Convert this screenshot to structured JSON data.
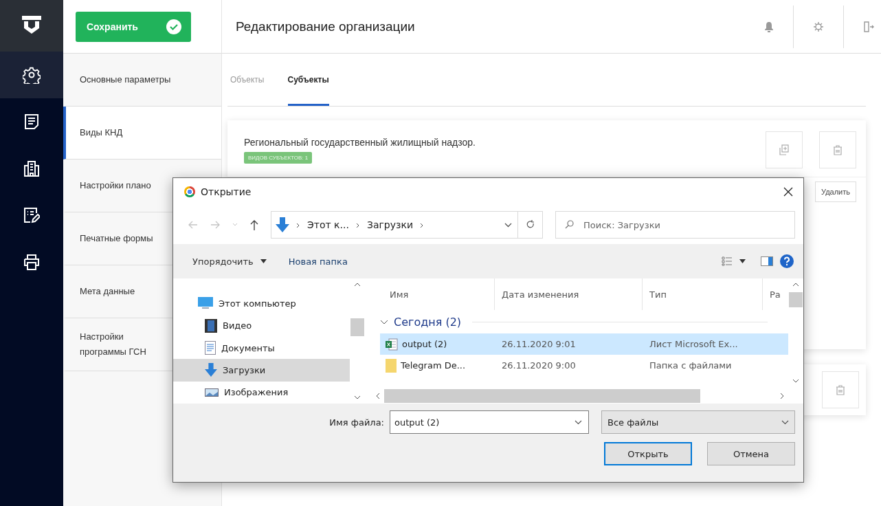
{
  "rail": [
    {
      "kind": "settings",
      "selected": true
    },
    {
      "kind": "document",
      "selected": false
    },
    {
      "kind": "building",
      "selected": false
    },
    {
      "kind": "form",
      "selected": false
    },
    {
      "kind": "printer",
      "selected": false
    }
  ],
  "header": {
    "save_button": "Сохранить",
    "title": "Редактирование организации"
  },
  "nav": [
    {
      "lines": [
        "Основные параметры"
      ],
      "selected": false
    },
    {
      "lines": [
        "Виды КНД"
      ],
      "selected": true
    },
    {
      "lines": [
        "Настройки плано"
      ],
      "selected": false
    },
    {
      "lines": [
        "Печатные формы"
      ],
      "selected": false
    },
    {
      "lines": [
        "Мета данные"
      ],
      "selected": false
    },
    {
      "lines": [
        "Настройки",
        "программы ГСН"
      ],
      "selected": false
    }
  ],
  "tabs": [
    {
      "label": "Объекты",
      "selected": false
    },
    {
      "label": "Субъекты",
      "selected": true
    }
  ],
  "card": {
    "title": "Региональный государственный жилищный надзор.",
    "badge": "ВИДОВ СУБЪЕКТОВ: 1",
    "delete_button": "Удалить"
  },
  "dialog": {
    "title": "Открытие",
    "breadcrumbs": [
      "Этот к...",
      "Загрузки"
    ],
    "search": {
      "placeholder": "Поиск: Загрузки"
    },
    "toolbar": {
      "organize": "Упорядочить",
      "new_folder": "Новая папка"
    },
    "tree": [
      {
        "label": "Этот компьютер",
        "kind": "computer",
        "selected": false,
        "children": [
          {
            "label": "Видео",
            "kind": "video",
            "selected": false
          },
          {
            "label": "Документы",
            "kind": "documents",
            "selected": false
          },
          {
            "label": "Загрузки",
            "kind": "downloads",
            "selected": true
          },
          {
            "label": "Изображения",
            "kind": "images",
            "selected": false
          }
        ]
      }
    ],
    "columns": [
      "Имя",
      "Дата изменения",
      "Тип",
      "Ра"
    ],
    "group": "Сегодня (2)",
    "files": [
      {
        "name": "output (2)",
        "date": "26.11.2020 9:01",
        "type": "Лист Microsoft Ex...",
        "kind": "excel",
        "selected": true
      },
      {
        "name": "Telegram De...",
        "date": "26.11.2020 9:00",
        "type": "Папка с файлами",
        "kind": "folder",
        "selected": false
      }
    ],
    "filename_label": "Имя файла:",
    "filename": "output (2)",
    "filter": "Все файлы",
    "open_button": "Открыть",
    "cancel_button": "Отмена"
  }
}
